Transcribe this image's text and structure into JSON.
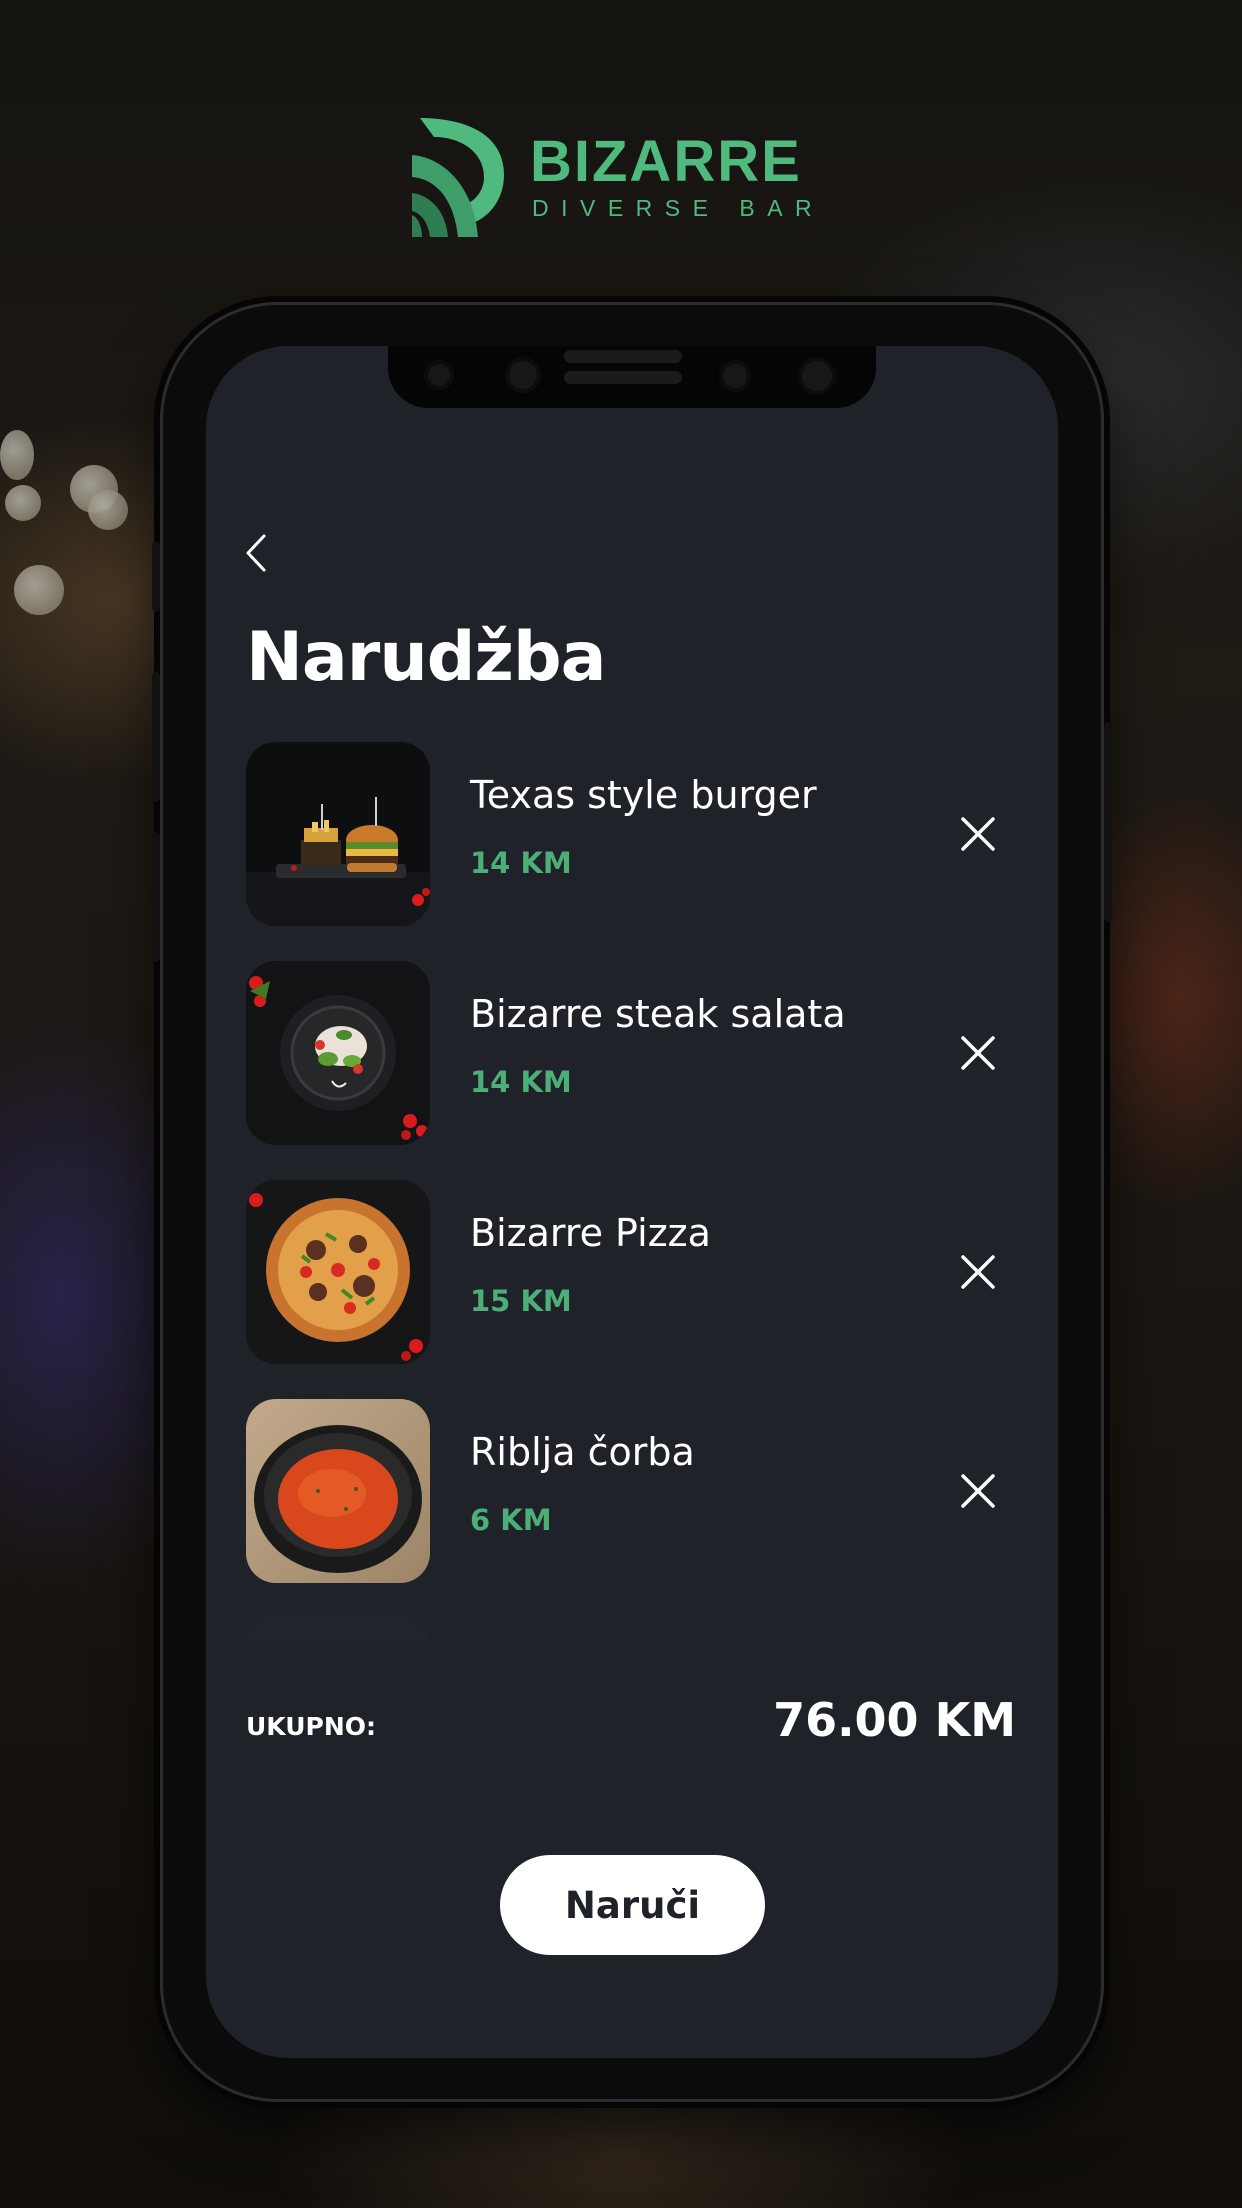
{
  "brand": {
    "name": "BIZARRE",
    "tagline": "DIVERSE BAR",
    "accent_color": "#4fb97e",
    "logo_icon": "bizarre-logo-mark"
  },
  "screen": {
    "back_icon": "chevron-left-icon",
    "title": "Narudžba"
  },
  "order": {
    "items": [
      {
        "name": "Texas style burger",
        "price": "14 KM",
        "image": "burger-photo"
      },
      {
        "name": "Bizarre steak salata",
        "price": "14 KM",
        "image": "salad-photo"
      },
      {
        "name": "Bizarre Pizza",
        "price": "15 KM",
        "image": "pizza-photo"
      },
      {
        "name": "Riblja čorba",
        "price": "6 KM",
        "image": "fish-soup-photo"
      }
    ],
    "remove_icon": "close-icon",
    "total_label": "UKUPNO:",
    "total_value": "76.00 KM",
    "order_button": "Naruči"
  },
  "colors": {
    "screen_bg": "#1f2229",
    "price": "#4caf78",
    "button_bg": "#ffffff"
  }
}
